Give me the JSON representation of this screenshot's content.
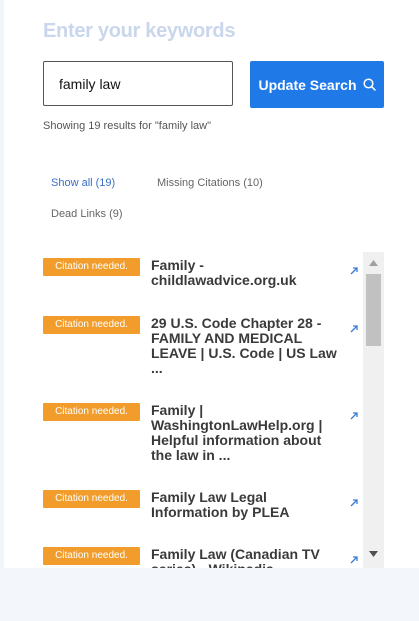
{
  "heading": "Enter your keywords",
  "search": {
    "value": "family law",
    "button_label": "Update Search"
  },
  "results_count": "Showing 19 results for \"family law\"",
  "filters": [
    {
      "label": "Show all (19)",
      "active": true
    },
    {
      "label": "Missing Citations (10)",
      "active": false
    },
    {
      "label": "Dead Links (9)",
      "active": false
    }
  ],
  "results": [
    {
      "badge": "Citation needed.",
      "title": "Family - childlawadvice.org.uk"
    },
    {
      "badge": "Citation needed.",
      "title": "29 U.S. Code Chapter 28 - FAMILY AND MEDICAL LEAVE | U.S. Code | US Law ..."
    },
    {
      "badge": "Citation needed.",
      "title": "Family | WashingtonLawHelp.org | Helpful information about the law in ..."
    },
    {
      "badge": "Citation needed.",
      "title": "Family Law Legal Information by PLEA"
    },
    {
      "badge": "Citation needed.",
      "title": "Family Law (Canadian TV series) - Wikipedia"
    }
  ],
  "colors": {
    "accent": "#1f7ae8",
    "badge": "#f29d2b",
    "heading": "#c9d6ec"
  }
}
